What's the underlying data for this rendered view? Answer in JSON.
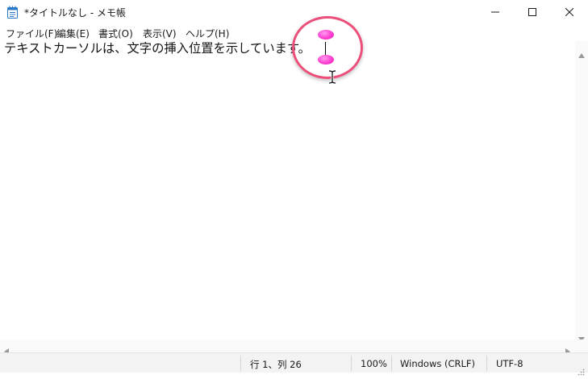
{
  "window": {
    "title": "*タイトルなし - メモ帳",
    "icon": "notepad-icon",
    "controls": [
      "minimize-icon",
      "maximize-icon",
      "close-icon"
    ]
  },
  "menu": {
    "items": [
      {
        "label": "ファイル(F)"
      },
      {
        "label": "編集(E)"
      },
      {
        "label": "書式(O)"
      },
      {
        "label": "表示(V)"
      },
      {
        "label": "ヘルプ(H)"
      }
    ]
  },
  "editor": {
    "text": "テキストカーソルは、文字の挿入位置を示しています。",
    "annotation_color": "#ec4f7a",
    "cursor_handle_color": "#ff3fd0"
  },
  "status": {
    "position": "行 1、列 26",
    "zoom": "100%",
    "line_ending": "Windows (CRLF)",
    "encoding": "UTF-8"
  }
}
